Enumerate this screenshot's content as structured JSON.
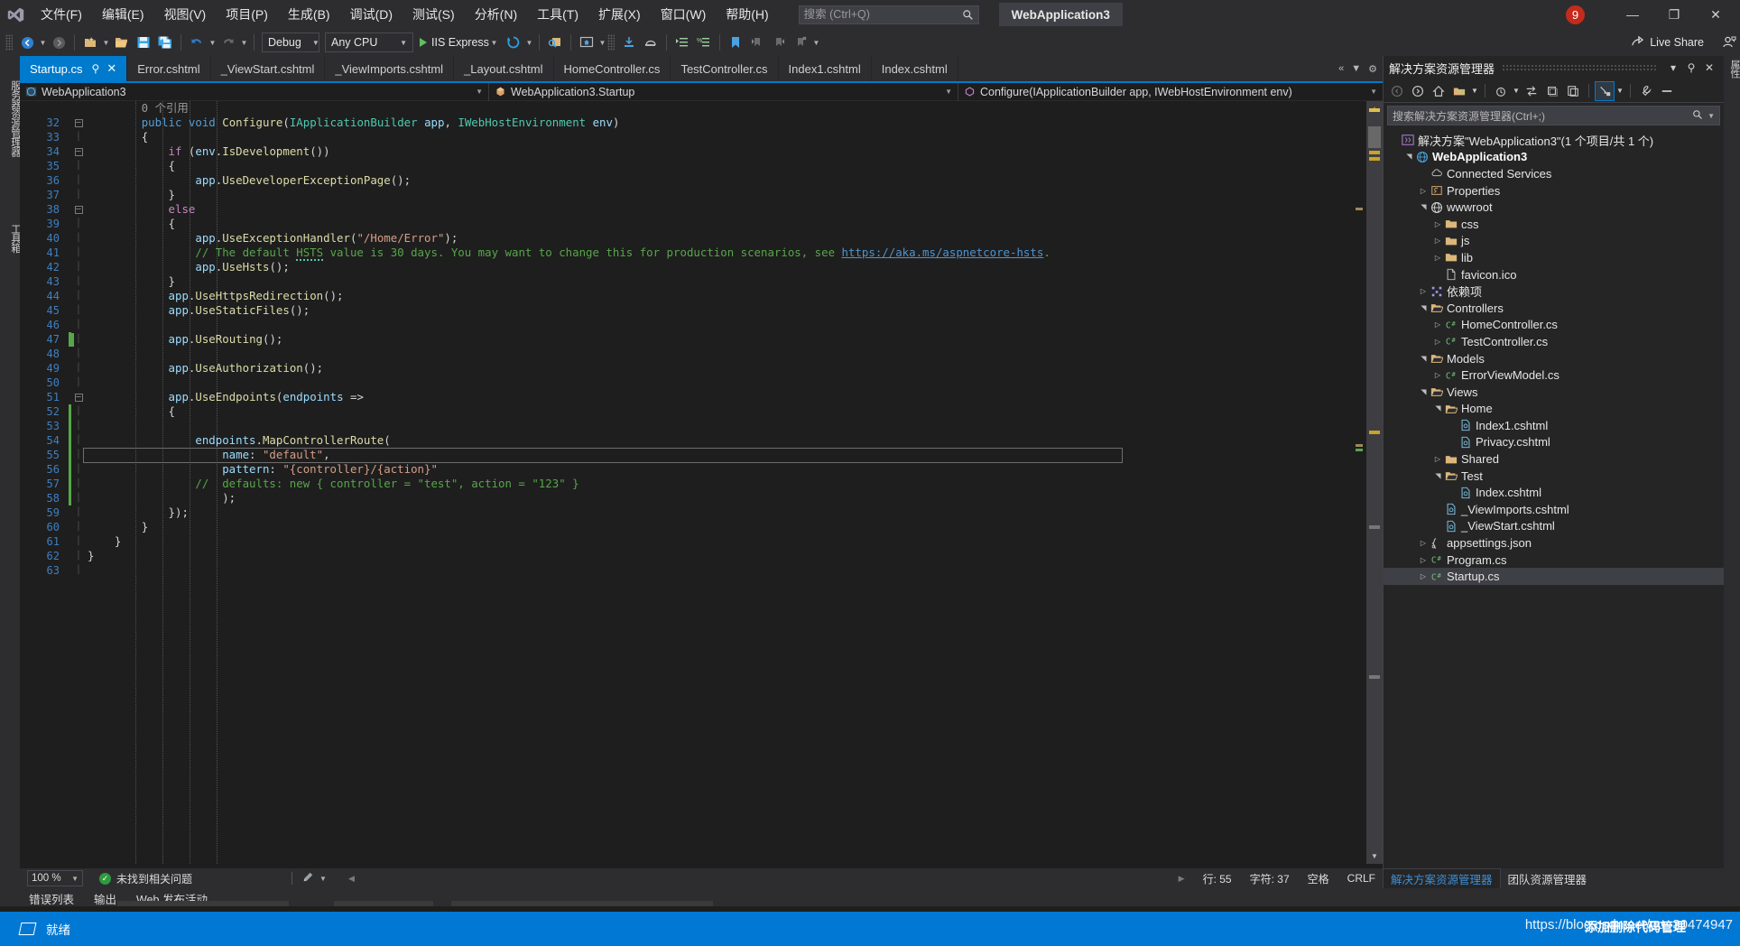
{
  "window": {
    "title_project": "WebApplication3",
    "notification_count": "9",
    "minimize": "—",
    "maximize": "❐",
    "close": "✕"
  },
  "menu": {
    "items": [
      {
        "label": "文件(F)",
        "name": "menu-file"
      },
      {
        "label": "编辑(E)",
        "name": "menu-edit"
      },
      {
        "label": "视图(V)",
        "name": "menu-view"
      },
      {
        "label": "项目(P)",
        "name": "menu-project"
      },
      {
        "label": "生成(B)",
        "name": "menu-build"
      },
      {
        "label": "调试(D)",
        "name": "menu-debug"
      },
      {
        "label": "测试(S)",
        "name": "menu-test"
      },
      {
        "label": "分析(N)",
        "name": "menu-analyze"
      },
      {
        "label": "工具(T)",
        "name": "menu-tools"
      },
      {
        "label": "扩展(X)",
        "name": "menu-extensions"
      },
      {
        "label": "窗口(W)",
        "name": "menu-window"
      },
      {
        "label": "帮助(H)",
        "name": "menu-help"
      }
    ]
  },
  "search": {
    "placeholder": "搜索 (Ctrl+Q)",
    "value": ""
  },
  "toolbar": {
    "configuration": "Debug",
    "platform": "Any CPU",
    "run_target": "IIS Express",
    "live_share": "Live Share"
  },
  "vertical_tabs": {
    "left_top": "服务器资源管理器",
    "left_bottom": "工具箱",
    "right": "属性"
  },
  "editor_tabs": [
    {
      "label": "Startup.cs",
      "active": true
    },
    {
      "label": "Error.cshtml",
      "active": false
    },
    {
      "label": "_ViewStart.cshtml",
      "active": false
    },
    {
      "label": "_ViewImports.cshtml",
      "active": false
    },
    {
      "label": "_Layout.cshtml",
      "active": false
    },
    {
      "label": "HomeController.cs",
      "active": false
    },
    {
      "label": "TestController.cs",
      "active": false
    },
    {
      "label": "Index1.cshtml",
      "active": false
    },
    {
      "label": "Index.cshtml",
      "active": false
    }
  ],
  "navbar": {
    "project": "WebApplication3",
    "type": "WebApplication3.Startup",
    "member": "Configure(IApplicationBuilder app, IWebHostEnvironment env)"
  },
  "code": {
    "reference_hint": "0 个引用",
    "reference_hint_line": 31,
    "first_line_number": 32,
    "lines": [
      {
        "n": 32,
        "fold": "minus",
        "indent": 2,
        "tokens": [
          {
            "t": "public",
            "c": "k"
          },
          {
            "t": " ",
            "c": "p"
          },
          {
            "t": "void",
            "c": "k"
          },
          {
            "t": " ",
            "c": "p"
          },
          {
            "t": "Configure",
            "c": "m"
          },
          {
            "t": "(",
            "c": "p"
          },
          {
            "t": "IApplicationBuilder",
            "c": "t"
          },
          {
            "t": " ",
            "c": "p"
          },
          {
            "t": "app",
            "c": "v"
          },
          {
            "t": ", ",
            "c": "p"
          },
          {
            "t": "IWebHostEnvironment",
            "c": "t"
          },
          {
            "t": " ",
            "c": "p"
          },
          {
            "t": "env",
            "c": "v"
          },
          {
            "t": ")",
            "c": "p"
          }
        ]
      },
      {
        "n": 33,
        "fold": "",
        "indent": 2,
        "tokens": [
          {
            "t": "{",
            "c": "p"
          }
        ]
      },
      {
        "n": 34,
        "fold": "minus",
        "indent": 3,
        "tokens": [
          {
            "t": "if",
            "c": "kc"
          },
          {
            "t": " (",
            "c": "p"
          },
          {
            "t": "env",
            "c": "v"
          },
          {
            "t": ".",
            "c": "p"
          },
          {
            "t": "IsDevelopment",
            "c": "m"
          },
          {
            "t": "())",
            "c": "p"
          }
        ]
      },
      {
        "n": 35,
        "fold": "",
        "indent": 3,
        "tokens": [
          {
            "t": "{",
            "c": "p"
          }
        ]
      },
      {
        "n": 36,
        "fold": "",
        "indent": 4,
        "tokens": [
          {
            "t": "app",
            "c": "v"
          },
          {
            "t": ".",
            "c": "p"
          },
          {
            "t": "UseDeveloperExceptionPage",
            "c": "m"
          },
          {
            "t": "();",
            "c": "p"
          }
        ]
      },
      {
        "n": 37,
        "fold": "",
        "indent": 3,
        "tokens": [
          {
            "t": "}",
            "c": "p"
          }
        ]
      },
      {
        "n": 38,
        "fold": "minus",
        "indent": 3,
        "tokens": [
          {
            "t": "else",
            "c": "kc"
          }
        ]
      },
      {
        "n": 39,
        "fold": "",
        "indent": 3,
        "tokens": [
          {
            "t": "{",
            "c": "p"
          }
        ]
      },
      {
        "n": 40,
        "fold": "",
        "indent": 4,
        "tokens": [
          {
            "t": "app",
            "c": "v"
          },
          {
            "t": ".",
            "c": "p"
          },
          {
            "t": "UseExceptionHandler",
            "c": "m"
          },
          {
            "t": "(",
            "c": "p"
          },
          {
            "t": "\"/Home/Error\"",
            "c": "s"
          },
          {
            "t": ");",
            "c": "p"
          }
        ]
      },
      {
        "n": 41,
        "fold": "",
        "indent": 4,
        "tokens": [
          {
            "t": "// The default ",
            "c": "c"
          },
          {
            "t": "HSTS",
            "c": "c squig"
          },
          {
            "t": " value is 30 days. You may want to change this for production scenarios, see ",
            "c": "c"
          },
          {
            "t": "https://aka.ms/aspnetcore-hsts",
            "c": "lnk"
          },
          {
            "t": ".",
            "c": "c"
          }
        ]
      },
      {
        "n": 42,
        "fold": "",
        "indent": 4,
        "tokens": [
          {
            "t": "app",
            "c": "v"
          },
          {
            "t": ".",
            "c": "p"
          },
          {
            "t": "UseHsts",
            "c": "m"
          },
          {
            "t": "();",
            "c": "p"
          }
        ]
      },
      {
        "n": 43,
        "fold": "",
        "indent": 3,
        "tokens": [
          {
            "t": "}",
            "c": "p"
          }
        ]
      },
      {
        "n": 44,
        "fold": "",
        "indent": 3,
        "tokens": [
          {
            "t": "app",
            "c": "v"
          },
          {
            "t": ".",
            "c": "p"
          },
          {
            "t": "UseHttpsRedirection",
            "c": "m"
          },
          {
            "t": "();",
            "c": "p"
          }
        ]
      },
      {
        "n": 45,
        "fold": "",
        "indent": 3,
        "tokens": [
          {
            "t": "app",
            "c": "v"
          },
          {
            "t": ".",
            "c": "p"
          },
          {
            "t": "UseStaticFiles",
            "c": "m"
          },
          {
            "t": "();",
            "c": "p"
          }
        ]
      },
      {
        "n": 46,
        "fold": "",
        "indent": 0,
        "tokens": []
      },
      {
        "n": 47,
        "fold": "",
        "indent": 3,
        "changed": true,
        "tokens": [
          {
            "t": "app",
            "c": "v"
          },
          {
            "t": ".",
            "c": "p"
          },
          {
            "t": "UseRouting",
            "c": "m"
          },
          {
            "t": "();",
            "c": "p"
          }
        ]
      },
      {
        "n": 48,
        "fold": "",
        "indent": 0,
        "tokens": []
      },
      {
        "n": 49,
        "fold": "",
        "indent": 3,
        "tokens": [
          {
            "t": "app",
            "c": "v"
          },
          {
            "t": ".",
            "c": "p"
          },
          {
            "t": "UseAuthorization",
            "c": "m"
          },
          {
            "t": "();",
            "c": "p"
          }
        ]
      },
      {
        "n": 50,
        "fold": "",
        "indent": 0,
        "tokens": []
      },
      {
        "n": 51,
        "fold": "minus",
        "indent": 3,
        "tokens": [
          {
            "t": "app",
            "c": "v"
          },
          {
            "t": ".",
            "c": "p"
          },
          {
            "t": "UseEndpoints",
            "c": "m"
          },
          {
            "t": "(",
            "c": "p"
          },
          {
            "t": "endpoints",
            "c": "v"
          },
          {
            "t": " =>",
            "c": "p"
          }
        ]
      },
      {
        "n": 52,
        "fold": "",
        "indent": 3,
        "changed": true,
        "tokens": [
          {
            "t": "{",
            "c": "p"
          }
        ]
      },
      {
        "n": 53,
        "fold": "",
        "indent": 0,
        "changed": true,
        "tokens": []
      },
      {
        "n": 54,
        "fold": "",
        "indent": 4,
        "changed": true,
        "tokens": [
          {
            "t": "endpoints",
            "c": "v"
          },
          {
            "t": ".",
            "c": "p"
          },
          {
            "t": "MapControllerRoute",
            "c": "m"
          },
          {
            "t": "(",
            "c": "p"
          }
        ]
      },
      {
        "n": 55,
        "fold": "",
        "indent": 5,
        "changed": true,
        "current": true,
        "tokens": [
          {
            "t": "name",
            "c": "v"
          },
          {
            "t": ": ",
            "c": "p"
          },
          {
            "t": "\"default\"",
            "c": "s"
          },
          {
            "t": ",",
            "c": "p"
          }
        ]
      },
      {
        "n": 56,
        "fold": "",
        "indent": 5,
        "changed": true,
        "tokens": [
          {
            "t": "pattern",
            "c": "v"
          },
          {
            "t": ": ",
            "c": "p"
          },
          {
            "t": "\"{controller}/{action}\"",
            "c": "s"
          }
        ]
      },
      {
        "n": 57,
        "fold": "",
        "indent": 4,
        "changed": true,
        "tokens": [
          {
            "t": "//  defaults: new { controller = \"test\", action = \"123\" }",
            "c": "c"
          }
        ]
      },
      {
        "n": 58,
        "fold": "",
        "indent": 5,
        "changed": true,
        "tokens": [
          {
            "t": ");",
            "c": "p"
          }
        ]
      },
      {
        "n": 59,
        "fold": "",
        "indent": 3,
        "tokens": [
          {
            "t": "});",
            "c": "p"
          }
        ]
      },
      {
        "n": 60,
        "fold": "",
        "indent": 2,
        "tokens": [
          {
            "t": "}",
            "c": "p"
          }
        ]
      },
      {
        "n": 61,
        "fold": "",
        "indent": 1,
        "tokens": [
          {
            "t": "}",
            "c": "p"
          }
        ]
      },
      {
        "n": 62,
        "fold": "",
        "indent": 0,
        "tokens": [
          {
            "t": "}",
            "c": "p"
          }
        ]
      },
      {
        "n": 63,
        "fold": "",
        "indent": 0,
        "tokens": []
      }
    ]
  },
  "editor_status": {
    "zoom": "100 %",
    "problems": "未找到相关问题",
    "line_label": "行: 55",
    "char_label": "字符: 37",
    "space_label": "空格",
    "eol_label": "CRLF"
  },
  "bottom_tabs": [
    {
      "label": "错误列表"
    },
    {
      "label": "输出"
    },
    {
      "label": "Web 发布活动"
    }
  ],
  "solution_explorer": {
    "title": "解决方案资源管理器",
    "search_placeholder": "搜索解决方案资源管理器(Ctrl+;)",
    "tree": [
      {
        "label": "解决方案\"WebApplication3\"(1 个项目/共 1 个)",
        "depth": 0,
        "arrow": "",
        "icon": "solution",
        "bold": false,
        "selected": false
      },
      {
        "label": "WebApplication3",
        "depth": 1,
        "arrow": "open",
        "icon": "project",
        "bold": true,
        "selected": false
      },
      {
        "label": "Connected Services",
        "depth": 2,
        "arrow": "",
        "icon": "cloud",
        "bold": false,
        "selected": false
      },
      {
        "label": "Properties",
        "depth": 2,
        "arrow": "closed",
        "icon": "properties",
        "bold": false,
        "selected": false
      },
      {
        "label": "wwwroot",
        "depth": 2,
        "arrow": "open",
        "icon": "globe",
        "bold": false,
        "selected": false
      },
      {
        "label": "css",
        "depth": 3,
        "arrow": "closed",
        "icon": "folder",
        "bold": false,
        "selected": false
      },
      {
        "label": "js",
        "depth": 3,
        "arrow": "closed",
        "icon": "folder",
        "bold": false,
        "selected": false
      },
      {
        "label": "lib",
        "depth": 3,
        "arrow": "closed",
        "icon": "folder",
        "bold": false,
        "selected": false
      },
      {
        "label": "favicon.ico",
        "depth": 3,
        "arrow": "",
        "icon": "file",
        "bold": false,
        "selected": false
      },
      {
        "label": "依赖项",
        "depth": 2,
        "arrow": "closed",
        "icon": "deps",
        "bold": false,
        "selected": false
      },
      {
        "label": "Controllers",
        "depth": 2,
        "arrow": "open",
        "icon": "folder-open",
        "bold": false,
        "selected": false
      },
      {
        "label": "HomeController.cs",
        "depth": 3,
        "arrow": "closed",
        "icon": "csharp",
        "bold": false,
        "selected": false
      },
      {
        "label": "TestController.cs",
        "depth": 3,
        "arrow": "closed",
        "icon": "csharp",
        "bold": false,
        "selected": false
      },
      {
        "label": "Models",
        "depth": 2,
        "arrow": "open",
        "icon": "folder-open",
        "bold": false,
        "selected": false
      },
      {
        "label": "ErrorViewModel.cs",
        "depth": 3,
        "arrow": "closed",
        "icon": "csharp",
        "bold": false,
        "selected": false
      },
      {
        "label": "Views",
        "depth": 2,
        "arrow": "open",
        "icon": "folder-open",
        "bold": false,
        "selected": false
      },
      {
        "label": "Home",
        "depth": 3,
        "arrow": "open",
        "icon": "folder-open",
        "bold": false,
        "selected": false
      },
      {
        "label": "Index1.cshtml",
        "depth": 4,
        "arrow": "",
        "icon": "cshtml",
        "bold": false,
        "selected": false
      },
      {
        "label": "Privacy.cshtml",
        "depth": 4,
        "arrow": "",
        "icon": "cshtml",
        "bold": false,
        "selected": false
      },
      {
        "label": "Shared",
        "depth": 3,
        "arrow": "closed",
        "icon": "folder",
        "bold": false,
        "selected": false
      },
      {
        "label": "Test",
        "depth": 3,
        "arrow": "open",
        "icon": "folder-open",
        "bold": false,
        "selected": false
      },
      {
        "label": "Index.cshtml",
        "depth": 4,
        "arrow": "",
        "icon": "cshtml",
        "bold": false,
        "selected": false
      },
      {
        "label": "_ViewImports.cshtml",
        "depth": 3,
        "arrow": "",
        "icon": "cshtml",
        "bold": false,
        "selected": false
      },
      {
        "label": "_ViewStart.cshtml",
        "depth": 3,
        "arrow": "",
        "icon": "cshtml",
        "bold": false,
        "selected": false
      },
      {
        "label": "appsettings.json",
        "depth": 2,
        "arrow": "closed",
        "icon": "json",
        "bold": false,
        "selected": false
      },
      {
        "label": "Program.cs",
        "depth": 2,
        "arrow": "closed",
        "icon": "csharp",
        "bold": false,
        "selected": false
      },
      {
        "label": "Startup.cs",
        "depth": 2,
        "arrow": "closed",
        "icon": "csharp",
        "bold": false,
        "selected": true
      }
    ],
    "footer_tabs": [
      {
        "label": "解决方案资源管理器",
        "active": true
      },
      {
        "label": "团队资源管理器",
        "active": false
      }
    ]
  },
  "taskbar": {
    "app_label": "就绪",
    "watermark": "https://blog.csdn.net/qq_30474947",
    "watermark_overlay": "添加删除代码管理"
  },
  "colors": {
    "accent": "#007acc",
    "taskbar": "#0078d4",
    "chrome": "#2d2d30",
    "editor_bg": "#1e1e1e",
    "panel_bg": "#252526",
    "notification": "#c42b1c"
  }
}
